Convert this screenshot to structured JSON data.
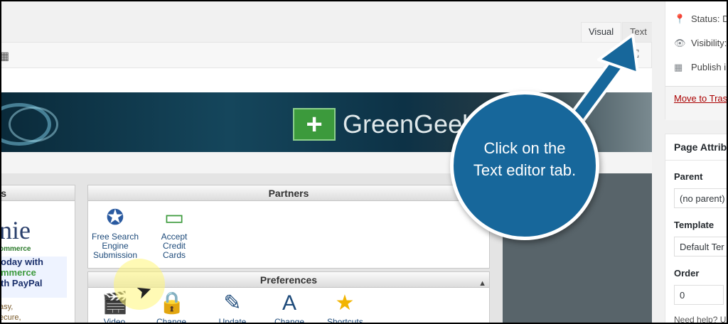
{
  "editor": {
    "tabs": {
      "visual": "Visual",
      "text": "Text"
    },
    "toolbar": {
      "left_icon": "table-icon",
      "right_icon": "fullscreen-icon"
    }
  },
  "cpanel": {
    "logo_text": "GreenGeel",
    "left_panel": {
      "brand": "nie",
      "brand_sub": "ommerce",
      "promo": [
        "oday with",
        "mmerce",
        "th PayPal"
      ],
      "tagline": [
        "asy,",
        "ecure,"
      ]
    },
    "partners": {
      "title": "Partners",
      "items": [
        {
          "label": "Free Search Engine Submission",
          "icon": "search-engine-icon"
        },
        {
          "label": "Accept Credit Cards",
          "icon": "credit-card-icon"
        }
      ]
    },
    "preferences": {
      "title": "Preferences",
      "items": [
        {
          "label": "Video",
          "icon": "video-icon"
        },
        {
          "label": "Change",
          "icon": "password-icon"
        },
        {
          "label": "Update",
          "icon": "update-contact-icon"
        },
        {
          "label": "Change",
          "icon": "language-icon"
        },
        {
          "label": "Shortcuts",
          "icon": "star-icon"
        }
      ]
    }
  },
  "callout": {
    "line1": "Click on the",
    "line2": "Text editor tab."
  },
  "sidebar": {
    "publish": {
      "status": "Status: D",
      "visibility": "Visibility:",
      "publish": "Publish i",
      "trash": "Move to Tras"
    },
    "attributes": {
      "title": "Page Attrib",
      "parent_label": "Parent",
      "parent_value": "(no parent)",
      "template_label": "Template",
      "template_value": "Default Ter",
      "order_label": "Order",
      "order_value": "0",
      "help": "Need help? U"
    }
  },
  "colors": {
    "callout": "#17679b",
    "trash_link": "#aa0000",
    "logo_green": "#3c9a3c"
  }
}
